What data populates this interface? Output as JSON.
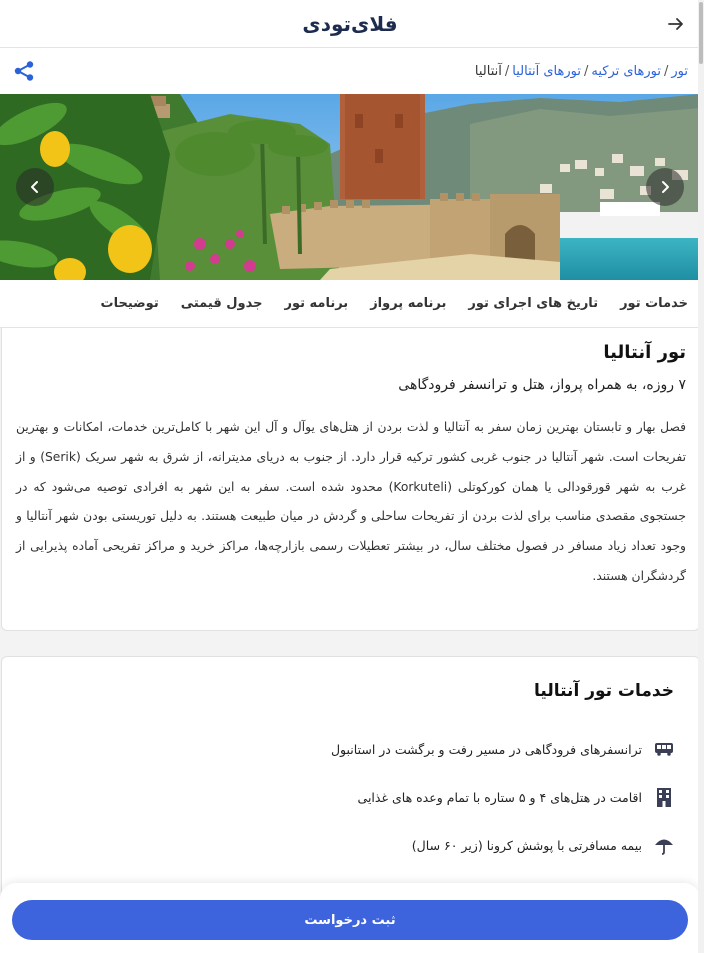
{
  "header": {
    "logo": "فلای‌تودی",
    "back_icon": "arrow-right-icon"
  },
  "breadcrumb": {
    "items": [
      "تور",
      "تورهای ترکیه",
      "تورهای آنتالیا",
      "آنتالیا"
    ],
    "share_icon": "share-icon"
  },
  "hero": {
    "next_icon": "chevron-right-icon",
    "prev_icon": "chevron-left-icon"
  },
  "tabs": [
    "خدمات تور",
    "تاریخ های اجرای تور",
    "برنامه پرواز",
    "برنامه تور",
    "جدول قیمتی",
    "توضیحات"
  ],
  "intro": {
    "title": "تور آنتالیا",
    "subtitle": "۷ روزه، به همراه پرواز، هتل و ترانسفر فرودگاهی",
    "description": "فصل بهار و تابستان بهترین زمان سفر به آنتالیا و لذت بردن از هتل‌های یوآل و آل این شهر با کامل‌ترین خدمات، امکانات و بهترین تفریحات است. شهر آنتالیا در جنوب غربی کشور ترکیه قرار دارد. از جنوب به دریای مدیترانه، از شرق به شهر سریک (Serik) و از غرب به شهر قورقودالی یا همان کورکوتلی (Korkuteli) محدود شده است. سفر به این شهر به افرادی توصیه می‌شود که در جستجوی مقصدی مناسب برای لذت بردن از تفریحات ساحلی و گردش در میان طبیعت هستند. به دلیل توریستی بودن شهر آنتالیا و وجود تعداد زیاد مسافر در فصول مختلف سال، در بیشتر تعطیلات رسمی بازارچه‌ها، مراکز خرید و مراکز تفریحی آماده پذیرایی از گردشگران هستند."
  },
  "services": {
    "title": "خدمات تور آنتالیا",
    "items": [
      {
        "icon": "bus-icon",
        "text": "ترانسفرهای فرودگاهی در مسیر رفت و برگشت در استانبول"
      },
      {
        "icon": "hotel-building-icon",
        "text": "اقامت در هتل‌های ۴ و ۵ ستاره با تمام وعده های غذایی"
      },
      {
        "icon": "umbrella-icon",
        "text": "بیمه مسافرتی با پوشش کرونا (زیر ۶۰ سال)"
      }
    ]
  },
  "footer": {
    "submit_label": "ثبت درخواست"
  },
  "colors": {
    "accent": "#3d63dd",
    "link": "#2962d9",
    "logo": "#1d2b4f"
  }
}
